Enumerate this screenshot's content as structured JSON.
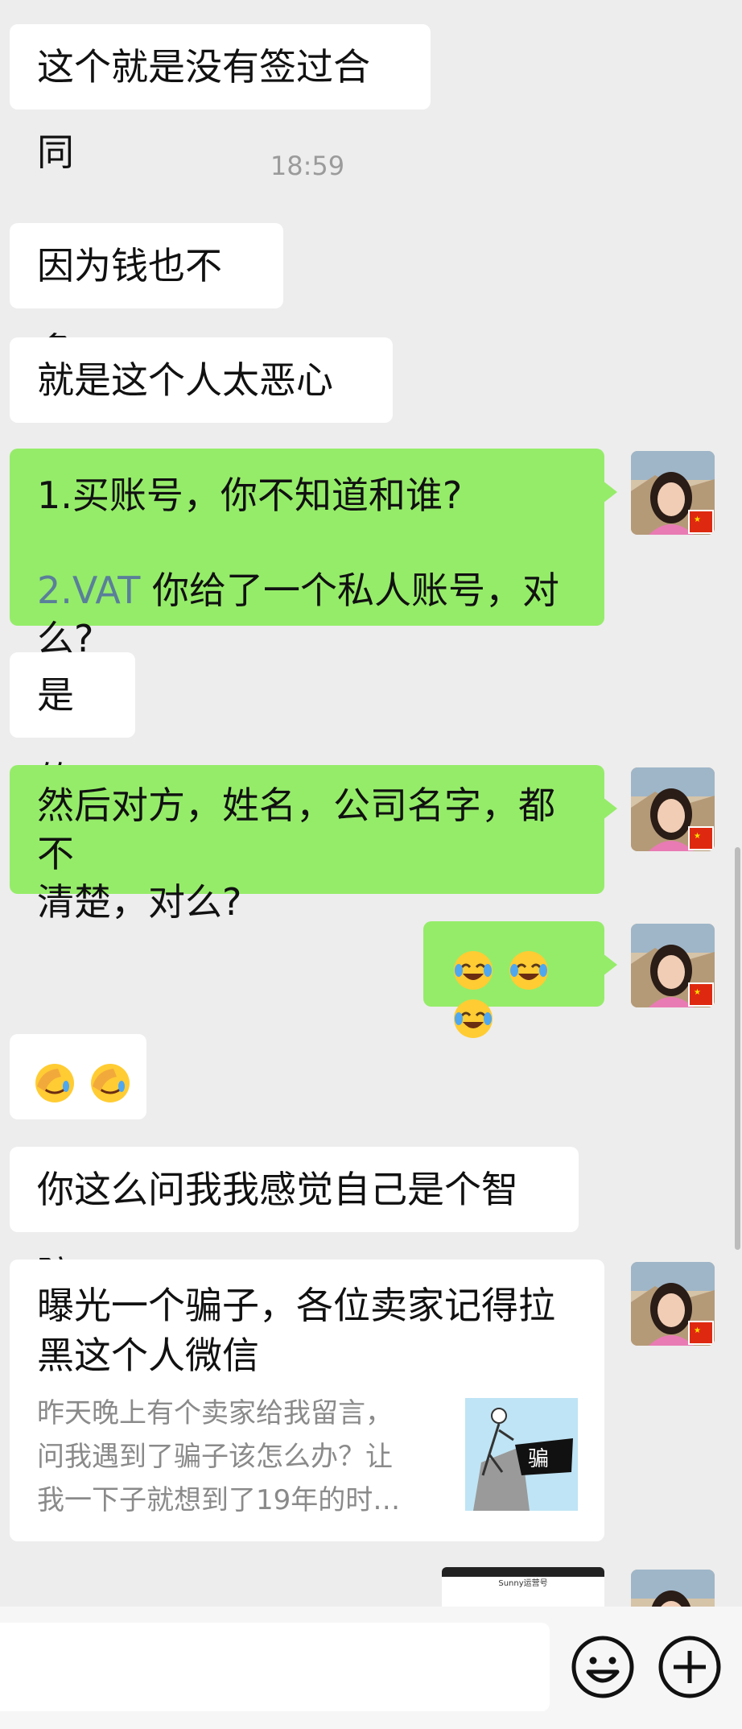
{
  "messages": {
    "m1": "这个就是没有签过合同",
    "time": "18:59",
    "m2": "因为钱也不多",
    "m3": "就是这个人太恶心了",
    "m4_line1": "1.买账号，你不知道和谁?",
    "m4_line2_prefix": "2.VAT",
    "m4_line2_rest": " 你给了一个私人账号，对么?",
    "m5": "是的",
    "m6_line1": "然后对方，姓名，公司名字，都不",
    "m6_line2": "清楚，对么?",
    "m7_emojis": [
      "tears-of-joy",
      "tears-of-joy",
      "tears-of-joy"
    ],
    "m8_emojis": [
      "facepalm",
      "facepalm"
    ],
    "m9": "你这么问我我感觉自己是个智障",
    "card": {
      "title_line1": "曝光一个骗子，各位卖家记得拉",
      "title_line2": "黑这个人微信",
      "desc_line1": "昨天晚上有个卖家给我留言，",
      "desc_line2": "问我遇到了骗子该怎么办？让",
      "desc_line3": "我一下子就想到了19年的时…",
      "thumb_text": "骗"
    },
    "preview_title": "Sunny运营号"
  },
  "colors": {
    "background": "#ededed",
    "bubble_self": "#95ec69",
    "bubble_other": "#ffffff",
    "vat_text": "#5a7f9a"
  },
  "icons": {
    "emoji_button": "smiley-icon",
    "plus_button": "plus-icon"
  }
}
